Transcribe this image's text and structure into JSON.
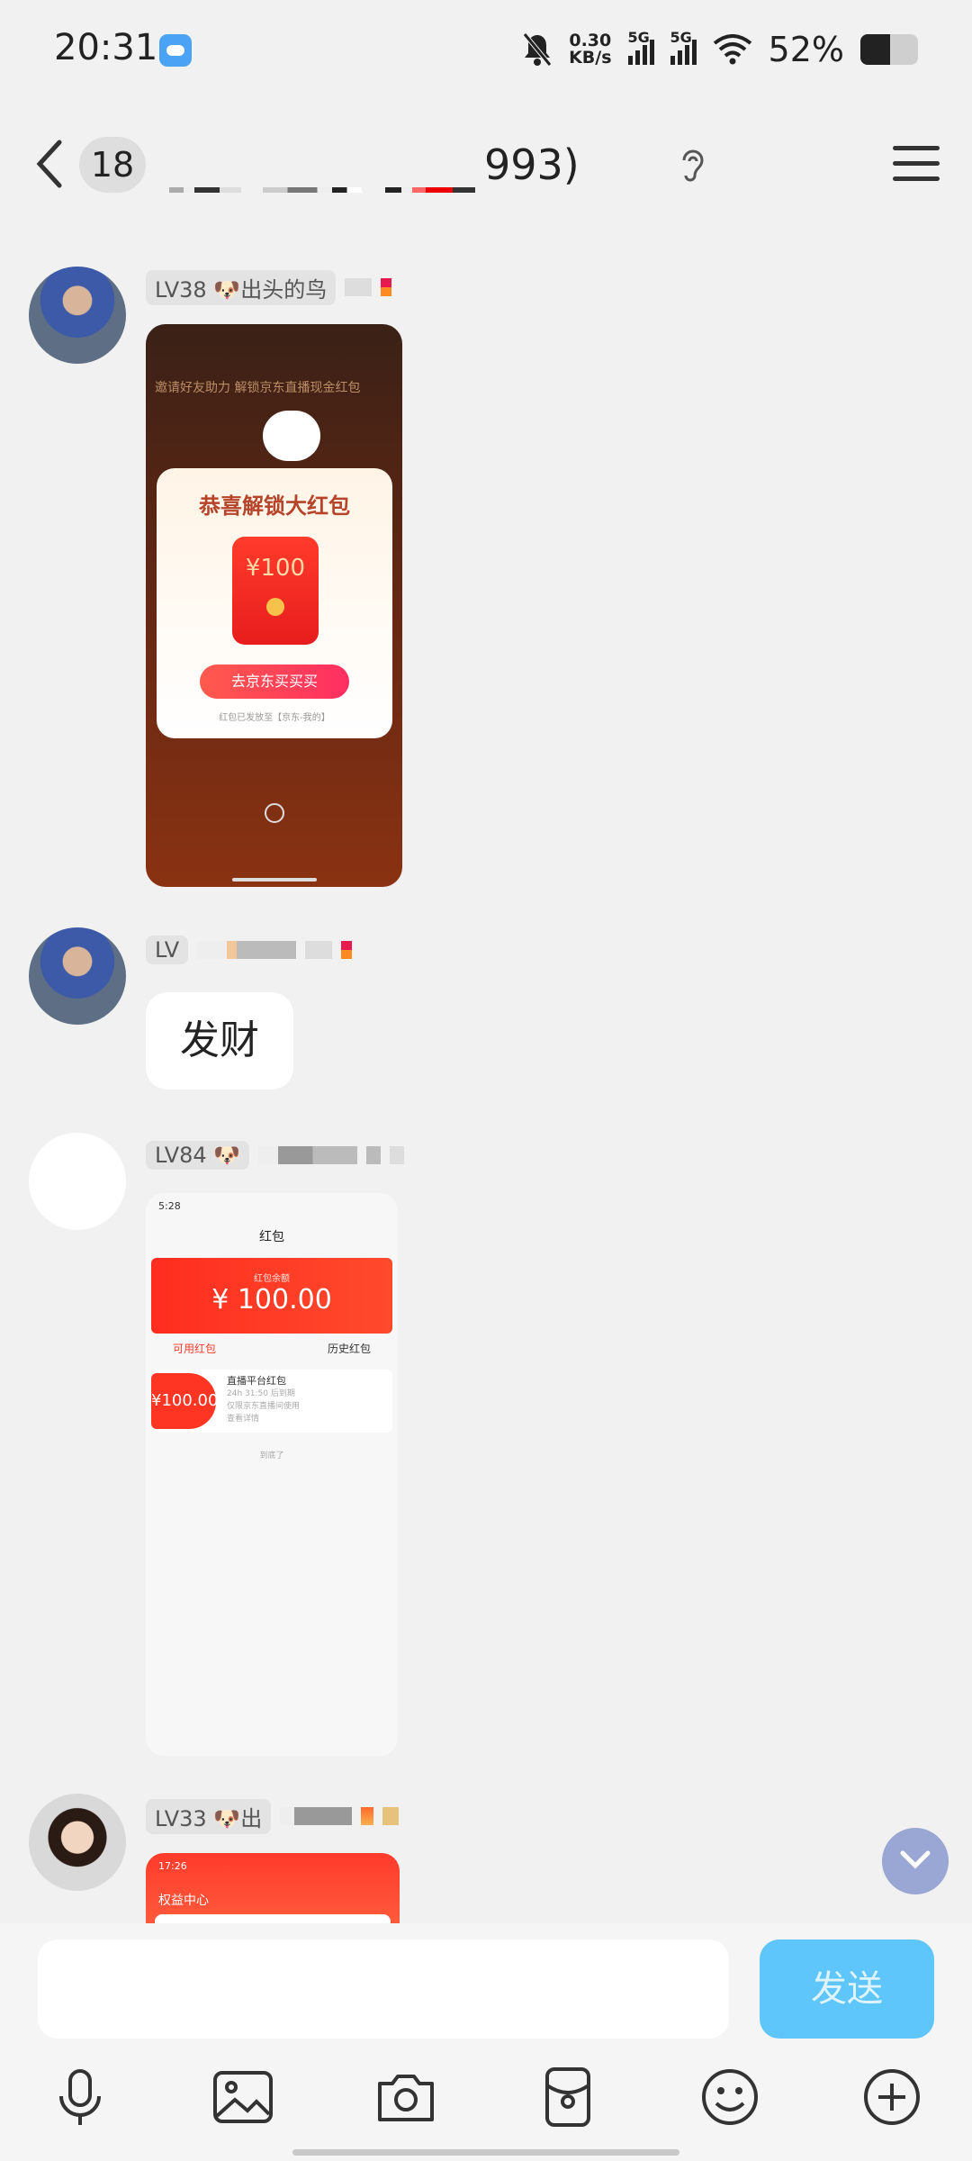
{
  "status_bar": {
    "time": "20:31",
    "net_speed_value": "0.30",
    "net_speed_unit": "KB/s",
    "sig1_label": "5G",
    "sig2_label": "5G",
    "battery_pct": "52%",
    "battery_level": 0.52
  },
  "header": {
    "unread_count": "18",
    "title_visible": "993)"
  },
  "messages": [
    {
      "level": "LV38 🐶出头的鸟",
      "image": {
        "banner_text": "邀请好友助力 解锁京东直播现金红包",
        "card_title": "恭喜解锁大红包",
        "amount": "¥100",
        "button": "去京东买买买",
        "note": "红包已发放至【京东-我的】"
      }
    },
    {
      "level": "LV",
      "text": "发财"
    },
    {
      "level": "LV84 🐶",
      "image": {
        "time": "5:28",
        "nav_title": "红包",
        "hero_label": "红包余额",
        "hero_amount": "¥ 100.00",
        "tab_active": "可用红包",
        "tab_other": "历史红包",
        "item_amount": "¥100.00",
        "item_title": "直播平台红包",
        "item_sub1": "24h 31:50 后到期",
        "item_sub2": "仅限京东直播间使用",
        "item_sub3": "查看详情",
        "end_text": "到底了"
      }
    },
    {
      "level": "LV33 🐶出",
      "image": {
        "time": "17:26",
        "nav_title": "权益中心"
      }
    }
  ],
  "composer": {
    "input_value": "",
    "send_label": "发送"
  },
  "icons": [
    "mic-icon",
    "image-icon",
    "camera-icon",
    "red-packet-icon",
    "emoji-icon",
    "plus-icon"
  ]
}
